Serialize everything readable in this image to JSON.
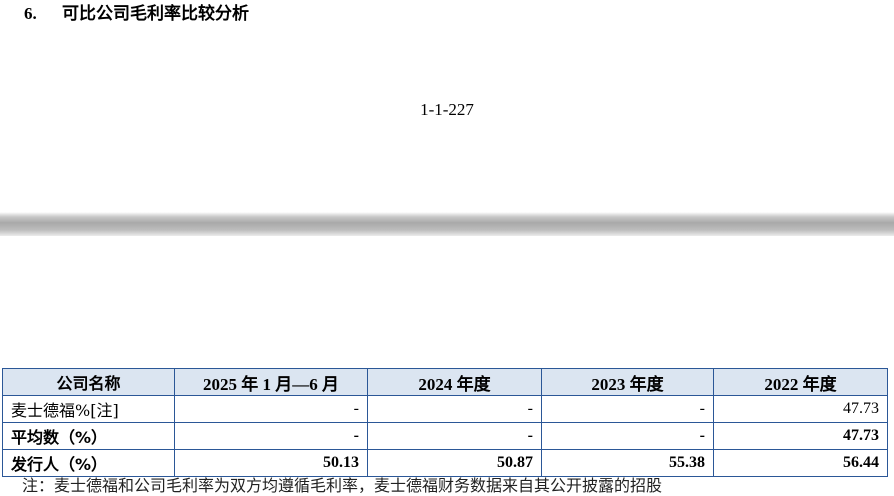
{
  "section": {
    "number": "6.",
    "title": "可比公司毛利率比较分析"
  },
  "page_number": "1-1-227",
  "table": {
    "headers": [
      "公司名称",
      "2025 年 1 月—6 月",
      "2024 年度",
      "2023 年度",
      "2022 年度"
    ],
    "rows": [
      {
        "name": "麦士德福%[注]",
        "values": [
          "-",
          "-",
          "-",
          "47.73"
        ]
      },
      {
        "name": "平均数（%）",
        "values": [
          "-",
          "-",
          "-",
          "47.73"
        ]
      },
      {
        "name": "发行人（%）",
        "values": [
          "50.13",
          "50.87",
          "55.38",
          "56.44"
        ]
      }
    ]
  },
  "footnote": "注：麦士德福和公司毛利率为双方均遵循毛利率，麦士德福财务数据来自其公开披露的招股"
}
